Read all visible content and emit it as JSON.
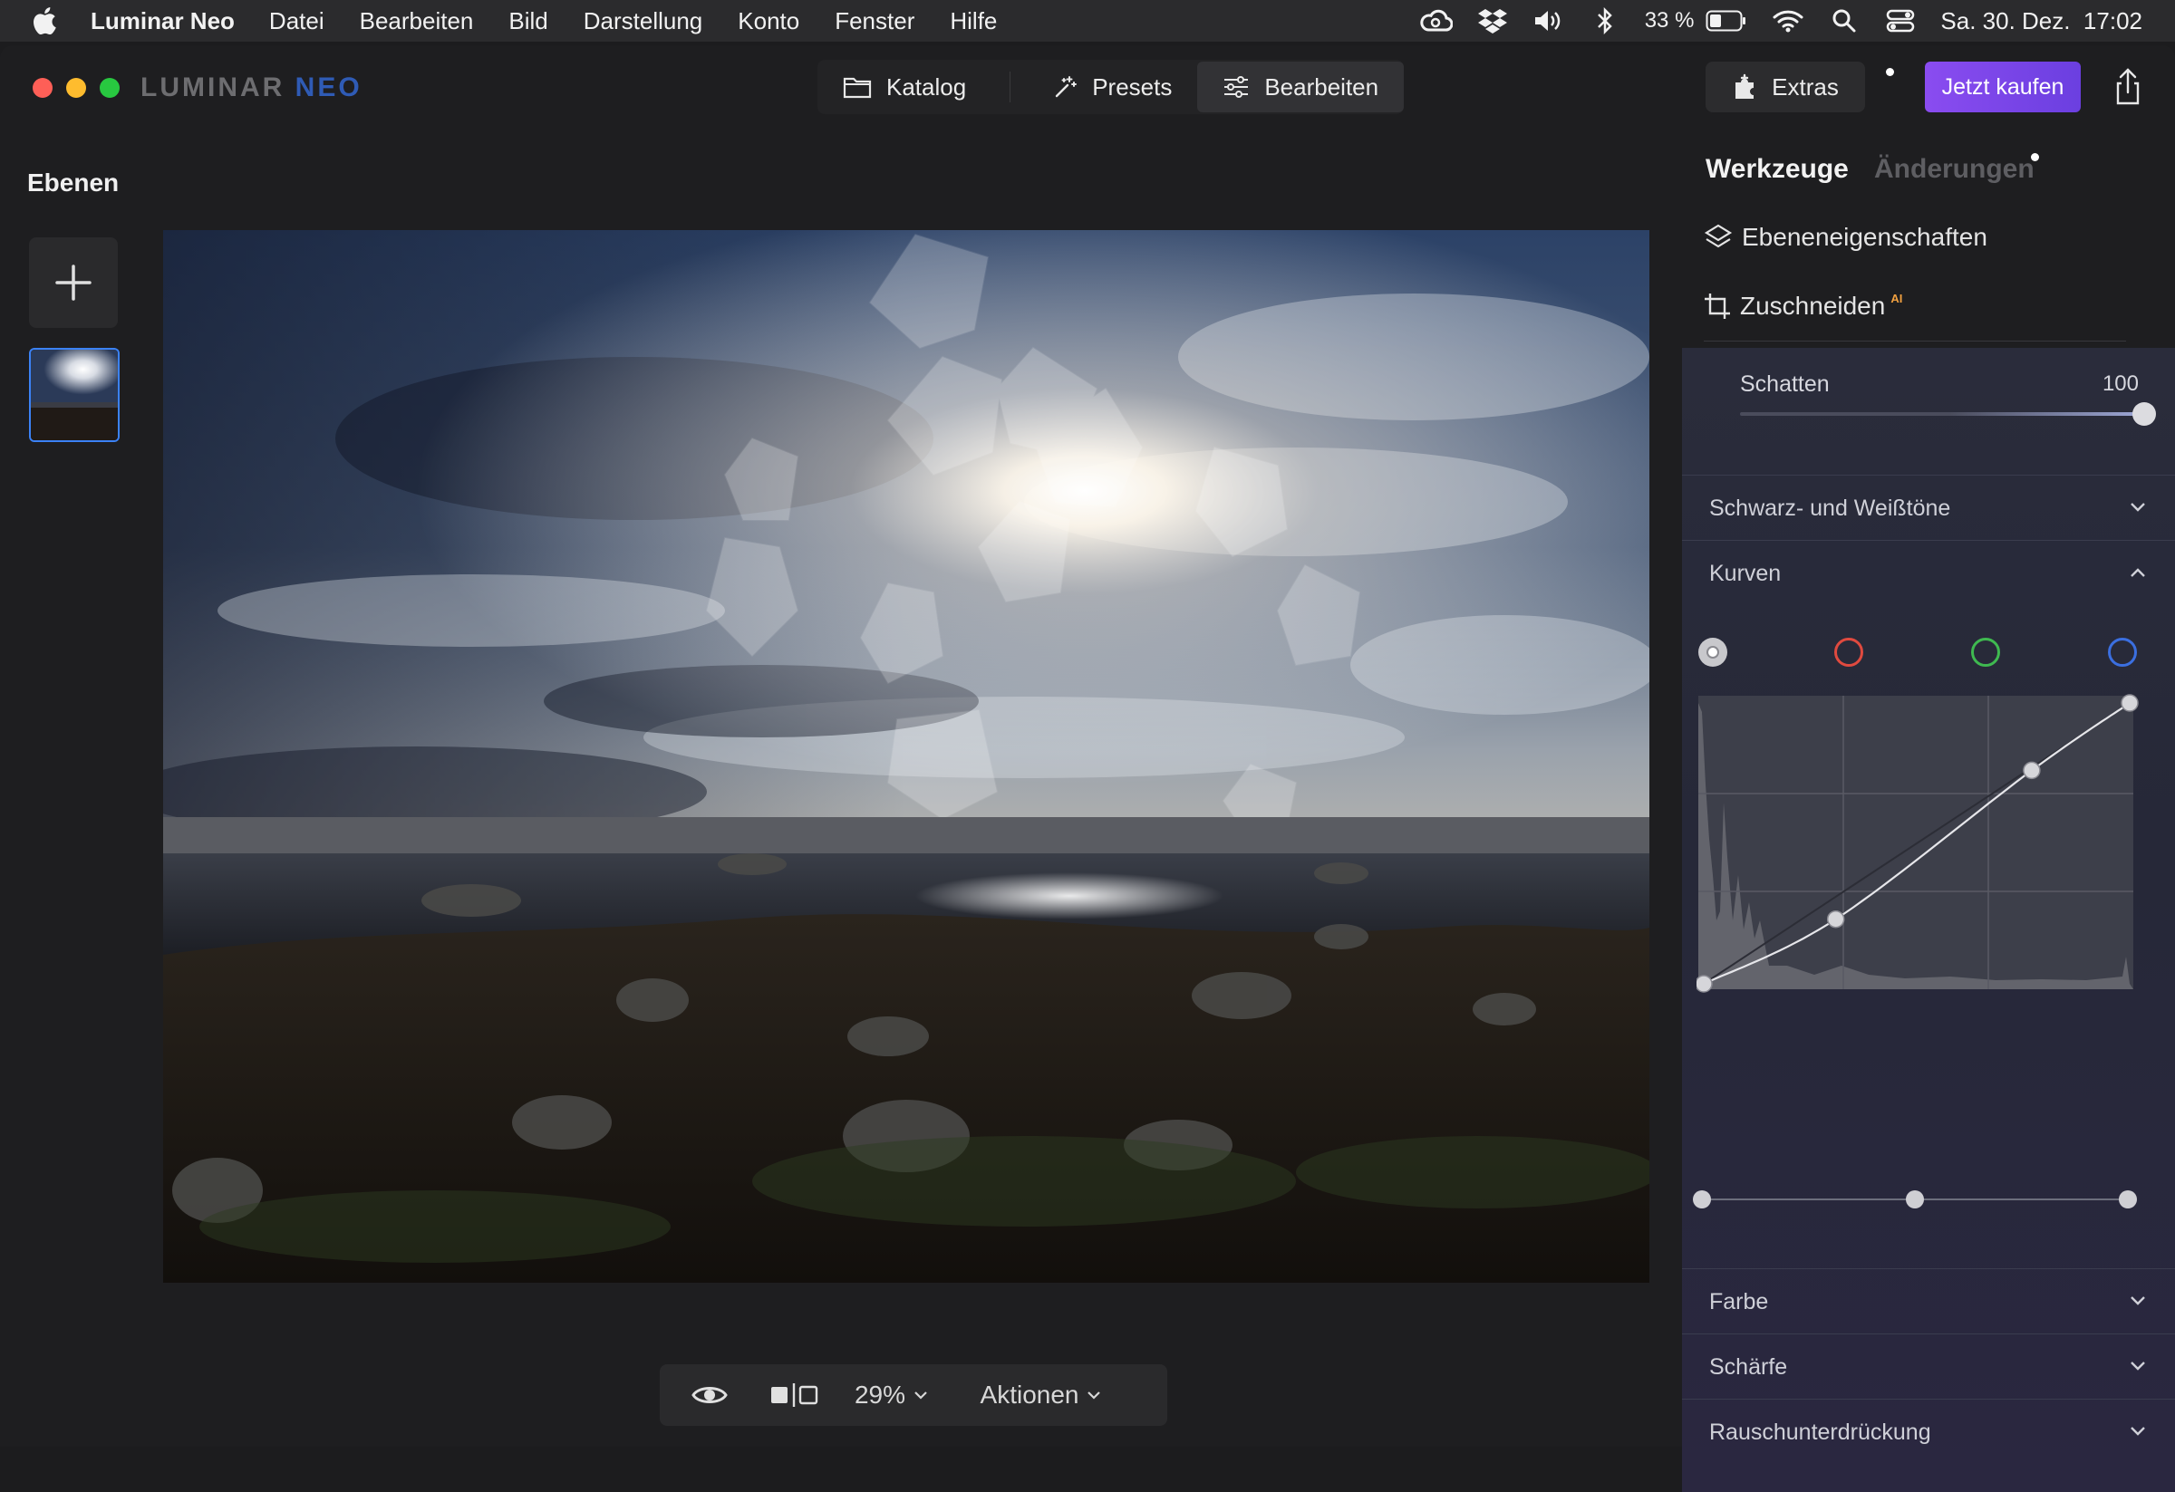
{
  "menubar": {
    "app_name": "Luminar Neo",
    "items": [
      "Datei",
      "Bearbeiten",
      "Bild",
      "Darstellung",
      "Konto",
      "Fenster",
      "Hilfe"
    ],
    "battery": "33 %",
    "datetime": "Sa. 30. Dez.  17:02"
  },
  "window": {
    "logo_main": "LUMINAR",
    "logo_neo": "NEO",
    "nav": {
      "catalog": "Katalog",
      "presets": "Presets",
      "edit": "Bearbeiten"
    },
    "extras_label": "Extras",
    "buy_label": "Jetzt kaufen"
  },
  "layers": {
    "title": "Ebenen"
  },
  "bottom_bar": {
    "zoom": "29%",
    "actions": "Aktionen"
  },
  "right_panel": {
    "tab_tools": "Werkzeuge",
    "tab_changes": "Änderungen",
    "layer_properties": "Ebeneneigenschaften",
    "crop": "Zuschneiden",
    "crop_badge": "AI",
    "shadow_label": "Schatten",
    "shadow_value": "100",
    "shadow_level": 1.0,
    "sections": {
      "black_white": "Schwarz- und Weißtöne",
      "curves": "Kurven",
      "color": "Farbe",
      "sharpness": "Schärfe",
      "noise": "Rauschunterdrückung"
    },
    "curve_channels": [
      "luminance",
      "red",
      "green",
      "blue"
    ],
    "curve_points": [
      [
        0,
        0
      ],
      [
        0.31,
        0.23
      ],
      [
        0.77,
        0.76
      ],
      [
        1,
        1
      ]
    ],
    "range_points": [
      0,
      0.5,
      1
    ]
  },
  "colors": {
    "accent_buy": "#7b47ea",
    "selection_blue": "#3b82f6",
    "channel_red": "#e04a3f",
    "channel_green": "#3fb950",
    "channel_blue": "#3b6fe0"
  }
}
